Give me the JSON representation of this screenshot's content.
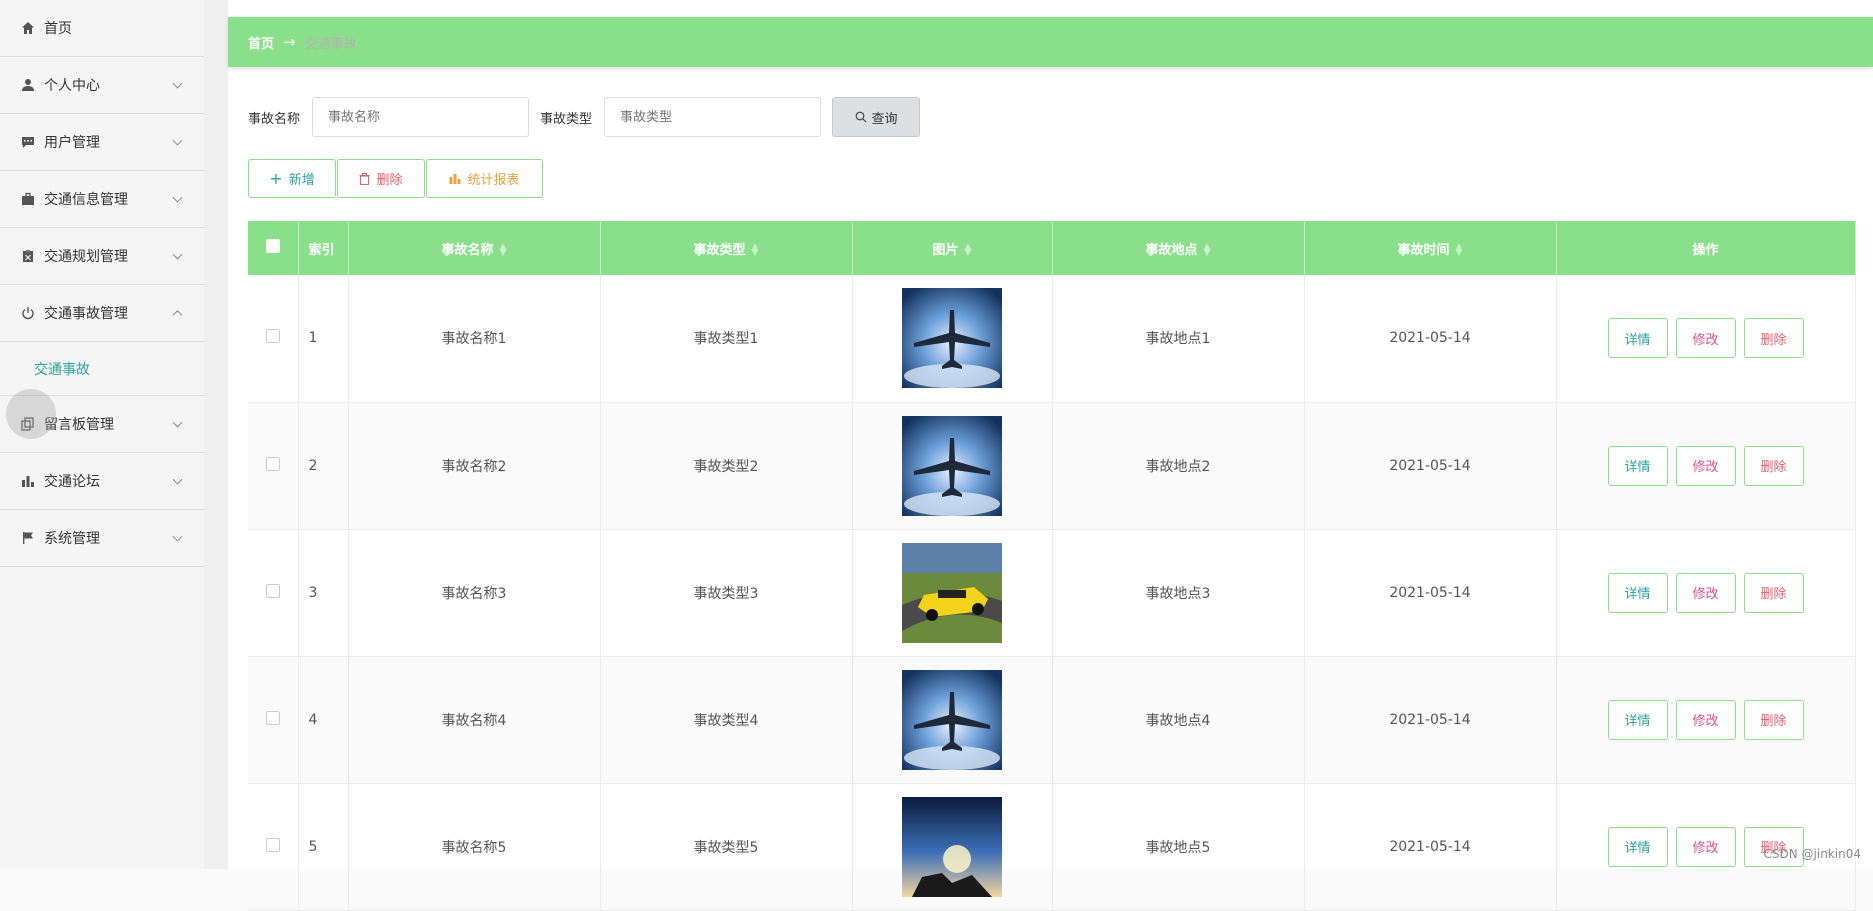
{
  "sidebar": {
    "items": [
      {
        "label": "首页",
        "icon": "home-icon",
        "has_children": false
      },
      {
        "label": "个人中心",
        "icon": "user-icon",
        "has_children": true
      },
      {
        "label": "用户管理",
        "icon": "chat-icon",
        "has_children": true
      },
      {
        "label": "交通信息管理",
        "icon": "briefcase-icon",
        "has_children": true
      },
      {
        "label": "交通规划管理",
        "icon": "clipboard-icon",
        "has_children": true
      },
      {
        "label": "交通事故管理",
        "icon": "power-icon",
        "has_children": true,
        "expanded": true
      },
      {
        "label": "交通事故",
        "submenu": true,
        "active": true
      },
      {
        "label": "留言板管理",
        "icon": "copy-icon",
        "has_children": true
      },
      {
        "label": "交通论坛",
        "icon": "bar-chart-icon",
        "has_children": true
      },
      {
        "label": "系统管理",
        "icon": "flag-icon",
        "has_children": true
      }
    ]
  },
  "breadcrumb": {
    "home": "首页",
    "arrow": "→",
    "current": "交通事故"
  },
  "search": {
    "name_label": "事故名称",
    "name_placeholder": "事故名称",
    "type_label": "事故类型",
    "type_placeholder": "事故类型",
    "query_label": "查询"
  },
  "actions": {
    "add_label": "新增",
    "delete_label": "删除",
    "report_label": "统计报表"
  },
  "table": {
    "columns": [
      "索引",
      "事故名称",
      "事故类型",
      "图片",
      "事故地点",
      "事故时间",
      "操作"
    ],
    "rows": [
      {
        "index": "1",
        "name": "事故名称1",
        "type": "事故类型1",
        "image": "airplane",
        "location": "事故地点1",
        "time": "2021-05-14"
      },
      {
        "index": "2",
        "name": "事故名称2",
        "type": "事故类型2",
        "image": "airplane",
        "location": "事故地点2",
        "time": "2021-05-14"
      },
      {
        "index": "3",
        "name": "事故名称3",
        "type": "事故类型3",
        "image": "racecar",
        "location": "事故地点3",
        "time": "2021-05-14"
      },
      {
        "index": "4",
        "name": "事故名称4",
        "type": "事故类型4",
        "image": "airplane",
        "location": "事故地点4",
        "time": "2021-05-14"
      },
      {
        "index": "5",
        "name": "事故名称5",
        "type": "事故类型5",
        "image": "motorcycle",
        "location": "事故地点5",
        "time": "2021-05-14"
      }
    ],
    "op_labels": {
      "detail": "详情",
      "edit": "修改",
      "delete": "删除"
    }
  },
  "colors": {
    "accent": "#8ae08a",
    "detail": "#2aa3a0",
    "edit": "#e0508e",
    "delete": "#e0606a",
    "report": "#e6a33e",
    "add": "#2aa3a0"
  },
  "watermark": "CSDN @jinkin04"
}
